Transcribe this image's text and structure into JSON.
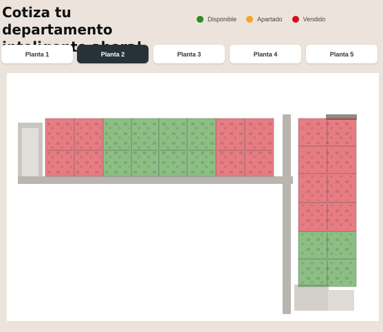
{
  "header": {
    "title": "Cotiza tu departamento inteligente ahora!"
  },
  "legend": [
    {
      "label": "Disponible",
      "color": "#2e8b1e"
    },
    {
      "label": "Apartado",
      "color": "#f2a623"
    },
    {
      "label": "Vendido",
      "color": "#d5101e"
    }
  ],
  "tabs": [
    {
      "label": "Planta 1",
      "active": false
    },
    {
      "label": "Planta 2",
      "active": true
    },
    {
      "label": "Planta 3",
      "active": false
    },
    {
      "label": "Planta 4",
      "active": false
    },
    {
      "label": "Planta 5",
      "active": false
    }
  ],
  "units": [
    {
      "id": "unit-top-1",
      "status": "vendido"
    },
    {
      "id": "unit-top-2",
      "status": "vendido"
    },
    {
      "id": "unit-top-3",
      "status": "disponible"
    },
    {
      "id": "unit-top-4",
      "status": "disponible"
    },
    {
      "id": "unit-top-5",
      "status": "disponible"
    },
    {
      "id": "unit-top-6",
      "status": "disponible"
    },
    {
      "id": "unit-top-7",
      "status": "vendido"
    },
    {
      "id": "unit-top-8",
      "status": "vendido"
    },
    {
      "id": "unit-right-1",
      "status": "vendido"
    },
    {
      "id": "unit-right-2",
      "status": "vendido"
    },
    {
      "id": "unit-right-3",
      "status": "vendido"
    },
    {
      "id": "unit-right-4",
      "status": "vendido"
    },
    {
      "id": "unit-right-5",
      "status": "disponible"
    },
    {
      "id": "unit-right-6",
      "status": "disponible"
    }
  ]
}
